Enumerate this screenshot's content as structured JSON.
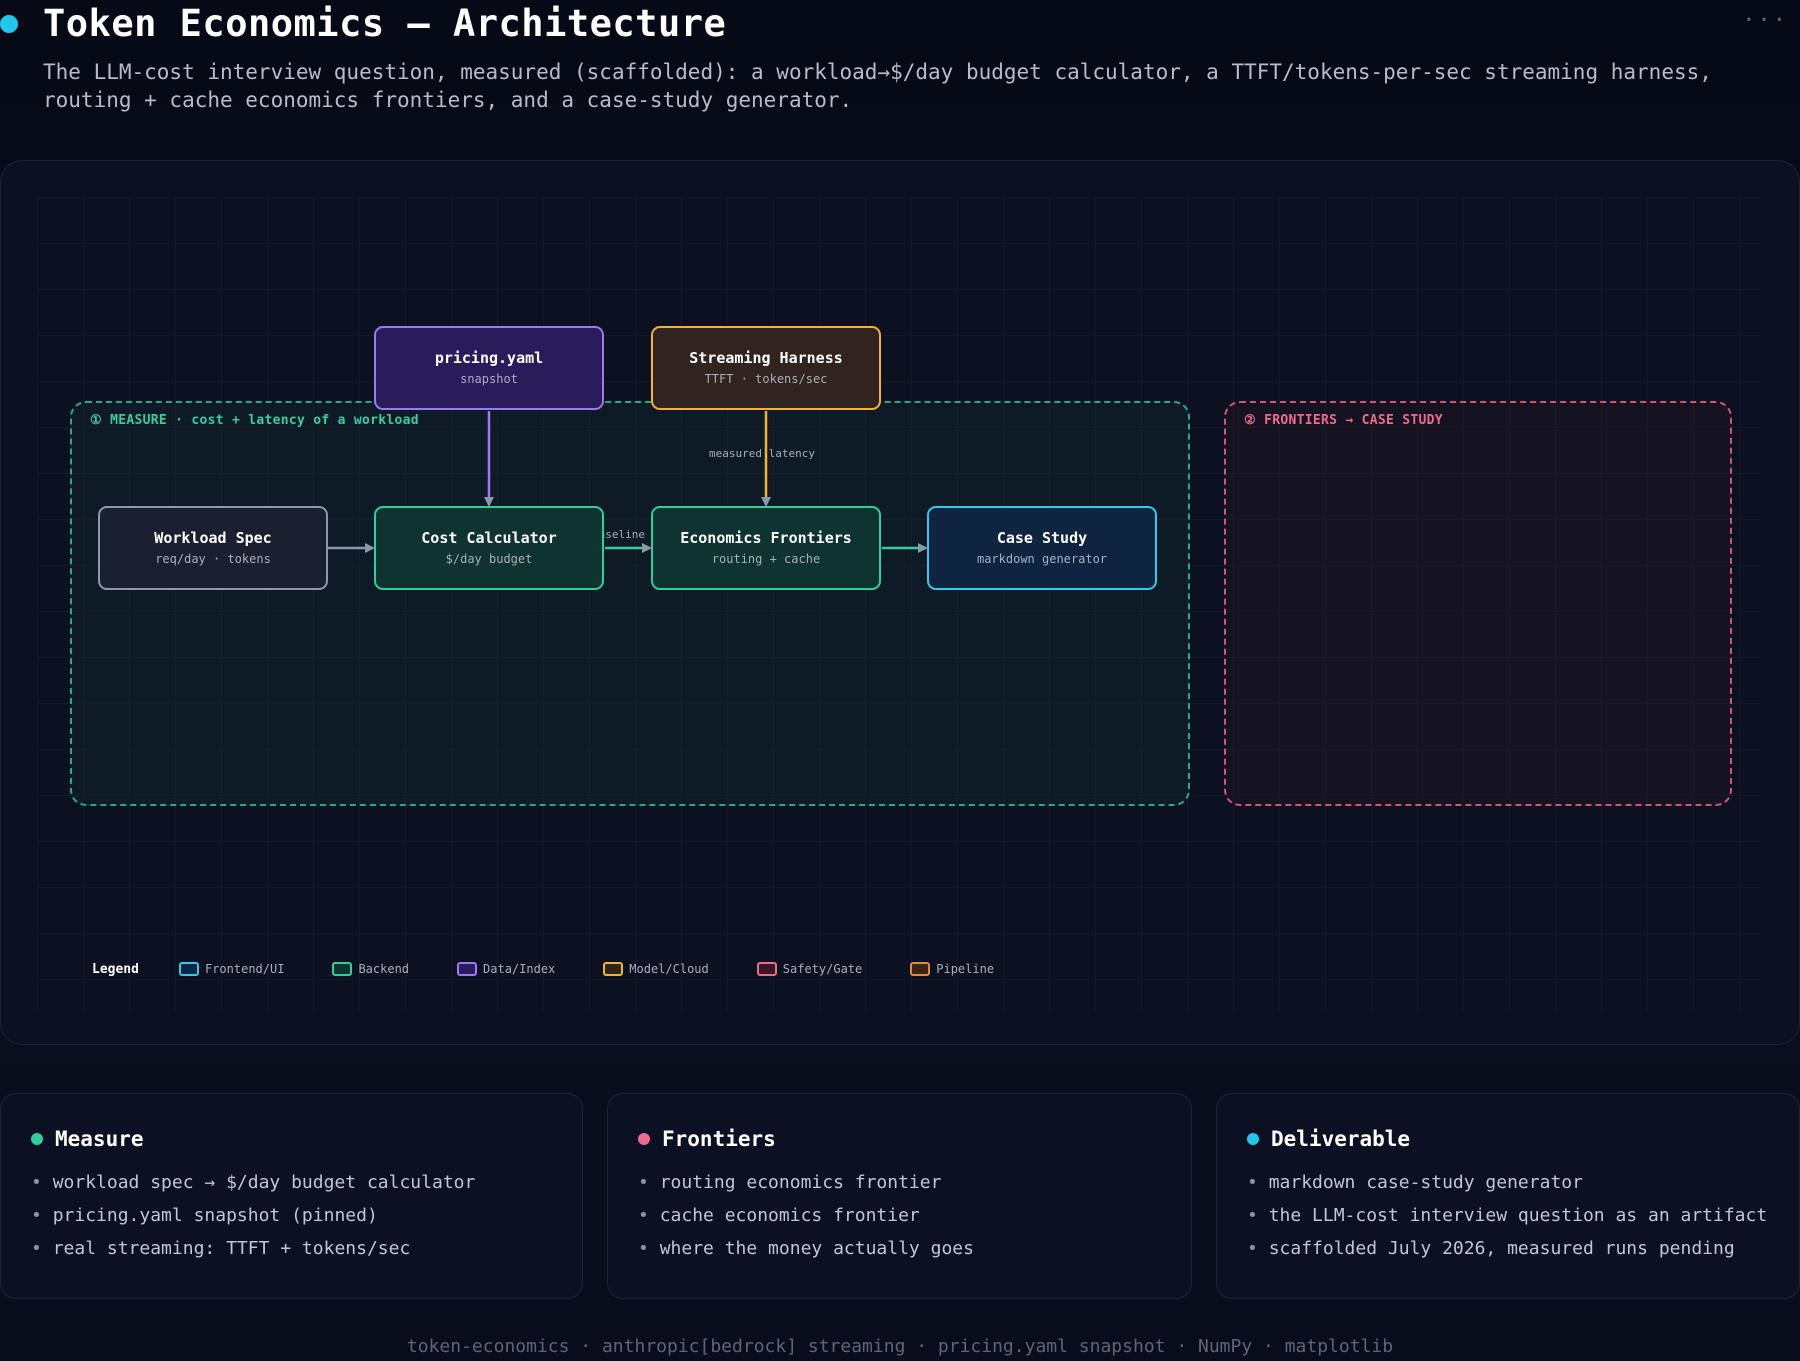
{
  "header": {
    "title": "Token Economics — Architecture",
    "subtitle": "The LLM-cost interview question, measured (scaffolded): a workload→$/day budget calculator, a TTFT/tokens-per-sec streaming harness, routing + cache economics frontiers, and a case-study generator.",
    "menu": "···",
    "accent": "#22c7ee"
  },
  "diagram": {
    "groups": {
      "measure": {
        "label": "① MEASURE · cost + latency of a workload",
        "color": "#2aa889"
      },
      "frontiers": {
        "label": "② FRONTIERS → CASE STUDY",
        "color": "#d2557a"
      }
    },
    "nodes": {
      "pricing": {
        "title": "pricing.yaml",
        "sub": "snapshot",
        "category": "Data/Index"
      },
      "stream": {
        "title": "Streaming Harness",
        "sub": "TTFT · tokens/sec",
        "category": "Model/Cloud"
      },
      "workload": {
        "title": "Workload Spec",
        "sub": "req/day · tokens",
        "category": "Frontend/UI"
      },
      "cost": {
        "title": "Cost Calculator",
        "sub": "$/day budget",
        "category": "Backend"
      },
      "econ": {
        "title": "Economics Frontiers",
        "sub": "routing + cache",
        "category": "Backend"
      },
      "case": {
        "title": "Case Study",
        "sub": "markdown generator",
        "category": "Frontend/UI"
      }
    },
    "edges": [
      {
        "from": "workload",
        "to": "cost",
        "label": ""
      },
      {
        "from": "pricing",
        "to": "cost",
        "label": ""
      },
      {
        "from": "cost",
        "to": "econ",
        "label": "baseline"
      },
      {
        "from": "stream",
        "to": "econ",
        "label": "measured latency"
      },
      {
        "from": "econ",
        "to": "case",
        "label": ""
      }
    ],
    "edge_labels": {
      "latency": "measured latency",
      "baseline": "baseline"
    },
    "legend": {
      "title": "Legend",
      "items": [
        {
          "label": "Frontend/UI",
          "color": "#36c8e6"
        },
        {
          "label": "Backend",
          "color": "#2ecf9a"
        },
        {
          "label": "Data/Index",
          "color": "#9a7bf0"
        },
        {
          "label": "Model/Cloud",
          "color": "#f2b233"
        },
        {
          "label": "Safety/Gate",
          "color": "#ef6b8d"
        },
        {
          "label": "Pipeline",
          "color": "#e08a4a"
        }
      ]
    }
  },
  "cards": {
    "measure": {
      "title": "Measure",
      "color": "#2ecf9a",
      "items": [
        "workload spec → $/day budget calculator",
        "pricing.yaml snapshot (pinned)",
        "real streaming: TTFT + tokens/sec"
      ]
    },
    "frontiers": {
      "title": "Frontiers",
      "color": "#ef6b8d",
      "items": [
        "routing economics frontier",
        "cache economics frontier",
        "where the money actually goes"
      ]
    },
    "deliverable": {
      "title": "Deliverable",
      "color": "#22c7ee",
      "items": [
        "markdown case-study generator",
        "the LLM-cost interview question as an artifact",
        "scaffolded July 2026, measured runs pending"
      ]
    }
  },
  "footer": "token-economics · anthropic[bedrock] streaming · pricing.yaml snapshot · NumPy · matplotlib"
}
